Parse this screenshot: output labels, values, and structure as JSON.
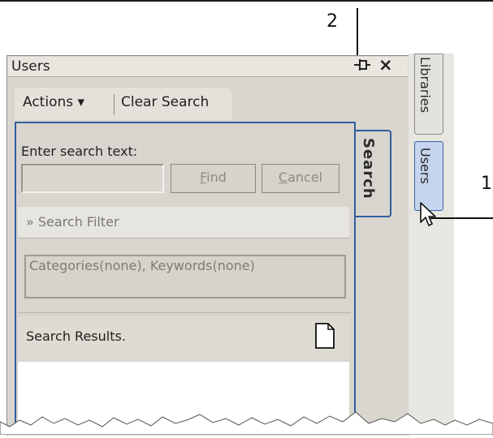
{
  "callouts": {
    "top": "2",
    "right": "1"
  },
  "panel": {
    "title": "Users",
    "pin_glyph": "-▫",
    "close_glyph": "×"
  },
  "toolbar": {
    "actions_label": "Actions ▾",
    "clear_search_label": "Clear Search"
  },
  "search": {
    "enter_label": "Enter search text:",
    "input_value": "",
    "find_label": "Find",
    "cancel_label": "Cancel",
    "filter_label": "» Search Filter",
    "categories_text": "Categories(none), Keywords(none)",
    "results_label": "Search Results."
  },
  "tabs": {
    "search": "Search",
    "libraries": "Libraries",
    "users": "Users"
  },
  "colors": {
    "accent_border": "#335c9f",
    "active_tab": "#c6d5ef",
    "panel_bg": "#d9d6cf"
  },
  "icons": [
    "pin-icon",
    "close-icon",
    "document-icon",
    "mouse-cursor-icon",
    "chevron-double-down-icon"
  ]
}
